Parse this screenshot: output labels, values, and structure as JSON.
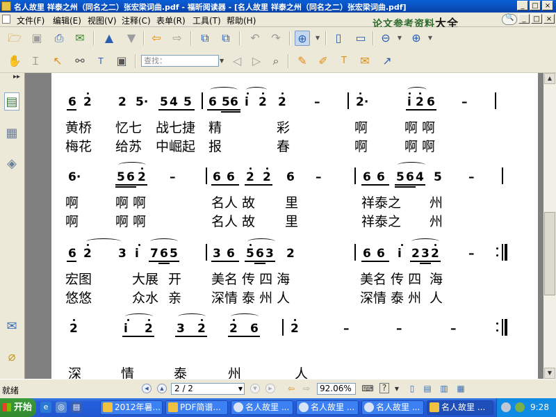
{
  "window": {
    "title": "名人故里 祥泰之州（同名之二）张宏梁词曲.pdf - 福昕阅读器 - [名人故里 祥泰之州（同名之二）张宏梁词曲.pdf]",
    "controls": [
      "_",
      "□",
      "×"
    ],
    "doc_controls": [
      "_",
      "□",
      "×"
    ]
  },
  "menubar": {
    "items": [
      "文件(F)",
      "编辑(E)",
      "视图(V)",
      "注释(C)",
      "表单(R)",
      "工具(T)",
      "帮助(H)"
    ],
    "brand": "论文参考资料",
    "brand_big": "大全"
  },
  "toolbar": {
    "find_placeholder": "查找："
  },
  "score": {
    "row1": {
      "notes": [
        "6",
        "2",
        "2",
        "5·",
        "5",
        "4",
        "5",
        "6",
        "5",
        "6",
        "i",
        "2",
        "2",
        "–",
        "2·",
        "i",
        "2",
        "6",
        "–"
      ],
      "lyrics1": [
        "黄桥",
        "忆七",
        "战七捷",
        "精",
        "彩",
        "啊",
        "啊 啊"
      ],
      "lyrics2": [
        "梅花",
        "给苏",
        "中崛起",
        "报",
        "春",
        "啊",
        "啊 啊"
      ]
    },
    "row2": {
      "notes": [
        "6·",
        "5",
        "6",
        "2",
        "–",
        "6",
        "6",
        "2",
        "2",
        "6",
        "–",
        "6",
        "6",
        "5",
        "6",
        "4",
        "5",
        "–"
      ],
      "lyrics1": [
        "啊",
        "啊 啊",
        "名人 故",
        "里",
        "祥泰之",
        "州"
      ],
      "lyrics2": [
        "啊",
        "啊 啊",
        "名人 故",
        "里",
        "祥泰之",
        "州"
      ]
    },
    "row3": {
      "notes": [
        "6",
        "2",
        "3",
        "i",
        "7",
        "6",
        "5",
        "3",
        "6",
        "5",
        "6",
        "3",
        "2",
        "6",
        "6",
        "i",
        "2",
        "3",
        "2",
        "–"
      ],
      "lyrics1": [
        "宏图",
        "大展",
        "开",
        "美名 传 四 海",
        "美名 传 四",
        "海"
      ],
      "lyrics2": [
        "悠悠",
        "众水",
        "亲",
        "深情 泰 州 人",
        "深情 泰 州",
        "人"
      ]
    },
    "row4": {
      "notes": [
        "2",
        "i",
        "2",
        "3",
        "2",
        "2",
        "6",
        "2",
        "–",
        "–",
        "–"
      ],
      "lyrics1": [
        "深",
        "情",
        "泰",
        "州",
        "人"
      ]
    }
  },
  "statusbar": {
    "ready": "就绪",
    "page": "2 / 2",
    "zoom": "92.06%"
  },
  "taskbar": {
    "start": "开始",
    "tasks": [
      "2012年暑...",
      "PDF简谱...",
      "名人故里 ...",
      "名人故里 ...",
      "名人故里 ...",
      "名人故里 ..."
    ],
    "clock": "9:28"
  }
}
